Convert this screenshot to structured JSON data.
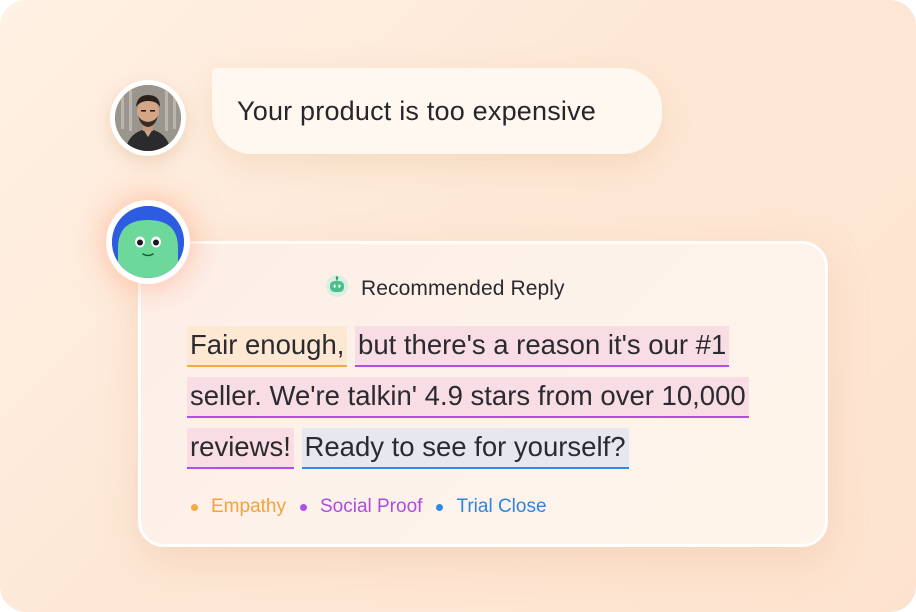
{
  "user_message": {
    "text": "Your product is too expensive"
  },
  "bot_icon": "robot-icon",
  "reply": {
    "title": "Recommended Reply",
    "segments": {
      "empathy": "Fair enough,",
      "social_proof_1": "but there's a reason it's our #1",
      "social_proof_2": "seller. We're talkin' 4.9 stars from over 10,000",
      "social_proof_3": "reviews!",
      "trial_close": "Ready to see for yourself?"
    }
  },
  "legend": {
    "empathy": {
      "label": "Empathy",
      "color": "#f5a940"
    },
    "social_proof": {
      "label": "Social Proof",
      "color": "#b24ee6"
    },
    "trial_close": {
      "label": "Trial Close",
      "color": "#2f8ae6"
    }
  },
  "colors": {
    "background": "#fde8d6",
    "bubble": "#fff8f0",
    "bot_avatar_bg": "#2d5ce0",
    "bot_face": "#6cd99a"
  }
}
